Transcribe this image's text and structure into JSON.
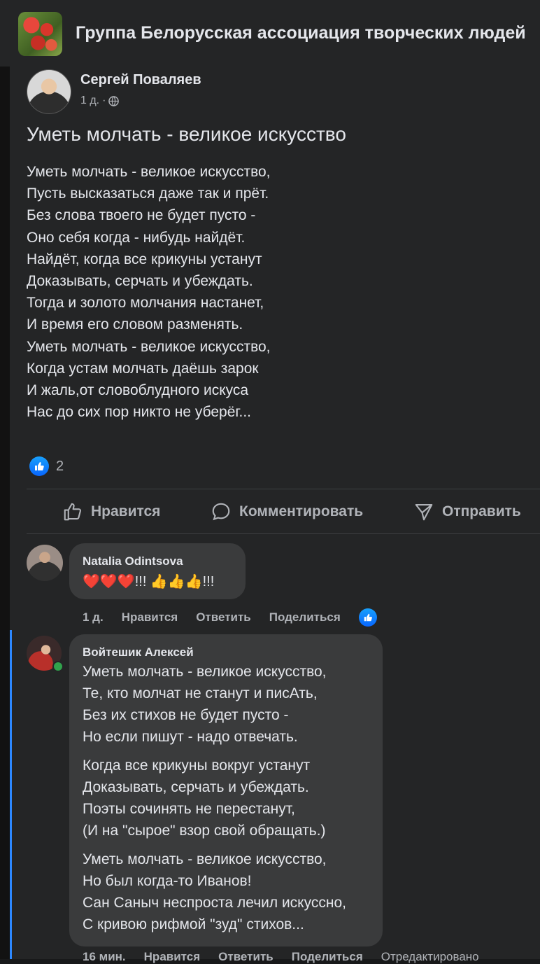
{
  "header": {
    "group_title": "Группа Белорусская ассоциация творческих людей"
  },
  "post": {
    "author": "Сергей Поваляев",
    "time": "1 д.",
    "separator": "·",
    "title": "Уметь молчать - великое искусство",
    "lines": [
      "Уметь молчать - великое искусство,",
      "Пусть высказаться даже так и прёт.",
      "Без слова твоего не будет пусто -",
      "Оно себя когда - нибудь найдёт.",
      "Найдёт, когда все крикуны устанут",
      "Доказывать, серчать и убеждать.",
      "Тогда и золото молчания настанет,",
      "И время его словом разменять.",
      "Уметь молчать - великое искусство,",
      "Когда устам молчать даёшь зарок",
      "И жаль,от словоблудного искуса",
      "Нас до сих пор никто не уберёг..."
    ],
    "reaction_count": "2"
  },
  "actions": {
    "like": "Нравится",
    "comment": "Комментировать",
    "share": "Отправить"
  },
  "comments": [
    {
      "name": "Natalia Odintsova",
      "text": "❤️❤️❤️!!! 👍👍👍!!!",
      "time": "1 д.",
      "like": "Нравится",
      "reply": "Ответить",
      "share": "Поделиться"
    },
    {
      "name": "Войтешик Алексей",
      "stanzas": [
        [
          "Уметь молчать - великое искусство,",
          "Те, кто молчат не станут и писАть,",
          "Без их стихов не будет пусто -",
          "Но если пишут - надо отвечать."
        ],
        [
          "Когда все крикуны вокруг устанут",
          "Доказывать, серчать и убеждать.",
          "Поэты сочинять не перестанут,",
          "(И на \"сырое\" взор свой обращать.)"
        ],
        [
          "Уметь молчать - великое искусство,",
          "Но был когда-то Иванов!",
          "Сан Саныч неспроста лечил искуссно,",
          "С кривою рифмой \"зуд\" стихов..."
        ]
      ],
      "time": "16 мин.",
      "like": "Нравится",
      "reply": "Ответить",
      "share": "Поделиться",
      "edited": "Отредактировано"
    }
  ],
  "colors": {
    "accent": "#0866ff",
    "background": "#242526",
    "bubble": "#3a3b3c"
  }
}
